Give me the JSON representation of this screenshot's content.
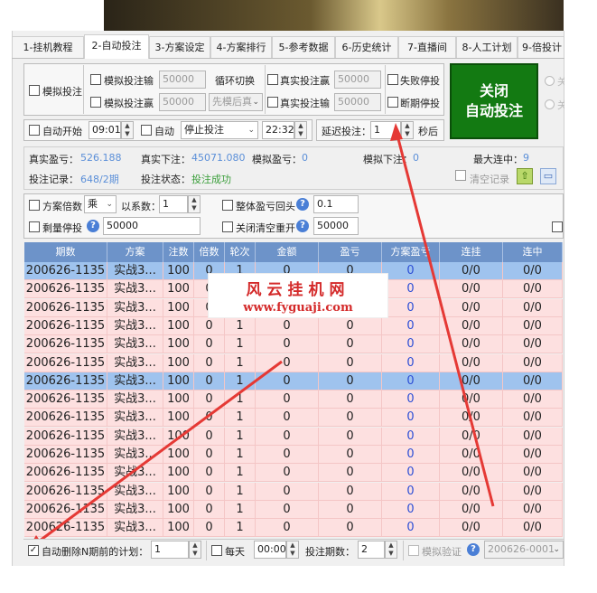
{
  "tabs": [
    {
      "label": "1-挂机教程",
      "active": false
    },
    {
      "label": "2-自动投注",
      "active": true
    },
    {
      "label": "3-方案设定",
      "active": false
    },
    {
      "label": "4-方案排行",
      "active": false
    },
    {
      "label": "5-参考数据",
      "active": false
    },
    {
      "label": "6-历史统计",
      "active": false
    },
    {
      "label": "7-直播间",
      "active": false
    },
    {
      "label": "8-人工计划",
      "active": false
    },
    {
      "label": "9-倍投计算",
      "active": false
    }
  ],
  "controls": {
    "sim_bet_label": "模拟投注",
    "sim_loss_label": "模拟投注输",
    "sim_loss_value": "50000",
    "sim_win_label": "模拟投注赢",
    "sim_win_value": "50000",
    "cycle_label": "循环切换",
    "cycle_select": "先模后真",
    "real_win_label": "真实投注赢",
    "real_win_value": "50000",
    "real_loss_label": "真实投注输",
    "real_loss_value": "50000",
    "fail_stop_label": "失败停投",
    "break_stop_label": "断期停投",
    "big_button_line1": "关闭",
    "big_button_line2": "自动投注",
    "radio1": "关",
    "radio2": "关",
    "auto_start_label": "自动开始",
    "auto_start_time": "09:01",
    "auto_label": "自动",
    "auto_select": "停止投注",
    "auto_time": "22:32",
    "delay_label": "延迟投注：",
    "delay_value": "1",
    "delay_unit": "秒后"
  },
  "stats": {
    "real_profit_label": "真实盈亏：",
    "real_profit_value": "526.188",
    "real_bet_label": "真实下注：",
    "real_bet_value": "45071.080",
    "sim_profit_label": "模拟盈亏：",
    "sim_profit_value": "0",
    "sim_bet_label": "模拟下注：",
    "sim_bet_value": "0",
    "max_streak_label": "最大连中：",
    "max_streak_value": "9",
    "record_label": "投注记录：",
    "record_value": "648/2期",
    "status_label": "投注状态：",
    "status_value": "投注成功",
    "clear_label": "清空记录"
  },
  "options": {
    "multiplier_label": "方案倍数",
    "multiplier_select": "乘",
    "coef_label": "以系数：",
    "coef_value": "1",
    "overall_label": "整体盈亏回头",
    "overall_value": "0.1",
    "remain_stop_label": "剩量停投",
    "remain_stop_value": "50000",
    "close_clear_label": "关闭清空重开",
    "close_clear_value": "50000"
  },
  "table": {
    "headers": [
      "期数",
      "方案",
      "注数",
      "倍数",
      "轮次",
      "金额",
      "盈亏",
      "方案盈亏",
      "连挂",
      "连中"
    ],
    "rows": [
      [
        "200626-1135",
        "实战3...",
        "100",
        "0",
        "1",
        "0",
        "0",
        "0",
        "0/0",
        "0/0"
      ],
      [
        "200626-1135",
        "实战3...",
        "100",
        "0",
        "1",
        "0",
        "0",
        "0",
        "0/0",
        "0/0"
      ],
      [
        "200626-1135",
        "实战3...",
        "100",
        "0",
        "1",
        "0",
        "0",
        "0",
        "0/0",
        "0/0"
      ],
      [
        "200626-1135",
        "实战3...",
        "100",
        "0",
        "1",
        "0",
        "0",
        "0",
        "0/0",
        "0/0"
      ],
      [
        "200626-1135",
        "实战3...",
        "100",
        "0",
        "1",
        "0",
        "0",
        "0",
        "0/0",
        "0/0"
      ],
      [
        "200626-1135",
        "实战3...",
        "100",
        "0",
        "1",
        "0",
        "0",
        "0",
        "0/0",
        "0/0"
      ],
      [
        "200626-1135",
        "实战3...",
        "100",
        "0",
        "1",
        "0",
        "0",
        "0",
        "0/0",
        "0/0"
      ],
      [
        "200626-1135",
        "实战3...",
        "100",
        "0",
        "1",
        "0",
        "0",
        "0",
        "0/0",
        "0/0"
      ],
      [
        "200626-1135",
        "实战3...",
        "100",
        "0",
        "1",
        "0",
        "0",
        "0",
        "0/0",
        "0/0"
      ],
      [
        "200626-1135",
        "实战3...",
        "100",
        "0",
        "1",
        "0",
        "0",
        "0",
        "0/0",
        "0/0"
      ],
      [
        "200626-1135",
        "实战3...",
        "100",
        "0",
        "1",
        "0",
        "0",
        "0",
        "0/0",
        "0/0"
      ],
      [
        "200626-1135",
        "实战3...",
        "100",
        "0",
        "1",
        "0",
        "0",
        "0",
        "0/0",
        "0/0"
      ],
      [
        "200626-1135",
        "实战3...",
        "100",
        "0",
        "1",
        "0",
        "0",
        "0",
        "0/0",
        "0/0"
      ],
      [
        "200626-1135",
        "实战3...",
        "100",
        "0",
        "1",
        "0",
        "0",
        "0",
        "0/0",
        "0/0"
      ],
      [
        "200626-1135",
        "实战3...",
        "100",
        "0",
        "1",
        "0",
        "0",
        "0",
        "0/0",
        "0/0"
      ]
    ],
    "highlight_rows": [
      0,
      6
    ]
  },
  "watermark": {
    "line1": "风云挂机网",
    "line2": "www.fyguaji.com"
  },
  "bottom": {
    "auto_delete_label": "自动删除N期前的计划：",
    "auto_delete_value": "1",
    "daily_label": "每天",
    "daily_time": "00:00",
    "bet_periods_label": "投注期数：",
    "bet_periods_value": "2",
    "sim_verify_label": "模拟验证",
    "period_select": "200626-0001"
  },
  "colors": {
    "header_bg": "#6d93c9",
    "row_bg": "#fde0e0",
    "row_highlight": "#9fc3ee",
    "big_button": "#137a12",
    "arrow": "#e53935"
  }
}
